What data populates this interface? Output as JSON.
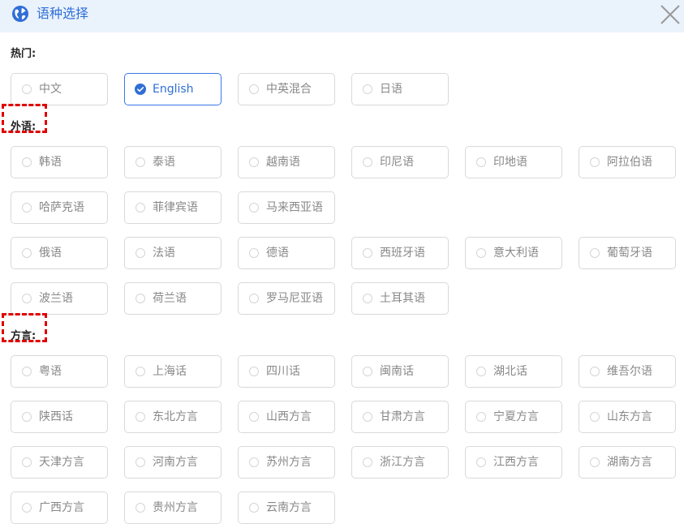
{
  "dialog": {
    "title": "语种选择"
  },
  "selected": "English",
  "colors": {
    "accent": "#2f6fd6",
    "header_bg": "#eaf2fc",
    "highlight": "#e00000"
  },
  "sections": [
    {
      "key": "hot",
      "label": "热门:",
      "highlighted": false,
      "rows": [
        [
          "中文",
          "English",
          "中英混合",
          "日语"
        ]
      ]
    },
    {
      "key": "foreign",
      "label": "外语:",
      "highlighted": true,
      "rows": [
        [
          "韩语",
          "泰语",
          "越南语",
          "印尼语",
          "印地语",
          "阿拉伯语"
        ],
        [
          "哈萨克语",
          "菲律宾语",
          "马来西亚语"
        ],
        [
          "俄语",
          "法语",
          "德语",
          "西班牙语",
          "意大利语",
          "葡萄牙语"
        ],
        [
          "波兰语",
          "荷兰语",
          "罗马尼亚语",
          "土耳其语"
        ]
      ]
    },
    {
      "key": "dialect",
      "label": "方言:",
      "highlighted": true,
      "rows": [
        [
          "粤语",
          "上海话",
          "四川话",
          "闽南话",
          "湖北话",
          "维吾尔语"
        ],
        [
          "陕西话",
          "东北方言",
          "山西方言",
          "甘肃方言",
          "宁夏方言",
          "山东方言"
        ],
        [
          "天津方言",
          "河南方言",
          "苏州方言",
          "浙江方言",
          "江西方言",
          "湖南方言"
        ],
        [
          "广西方言",
          "贵州方言",
          "云南方言"
        ]
      ]
    }
  ]
}
